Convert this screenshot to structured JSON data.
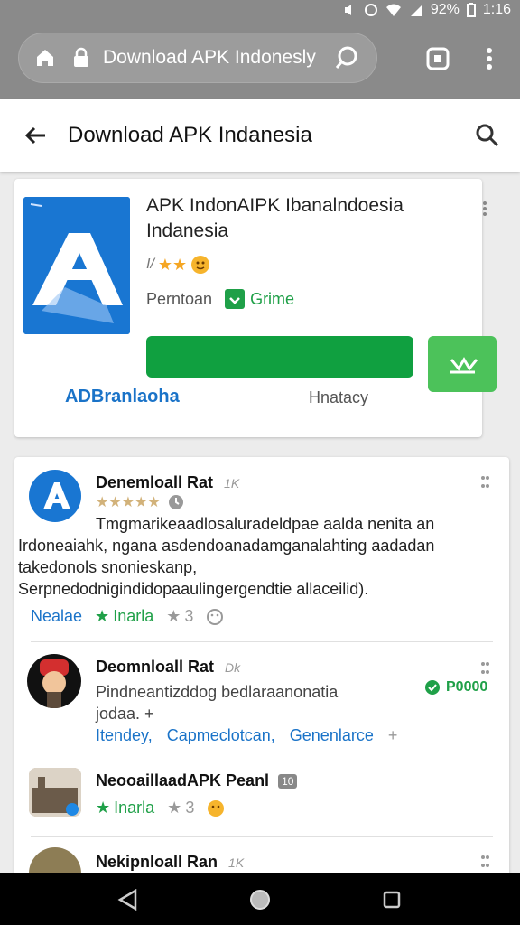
{
  "status": {
    "battery": "92%",
    "time": "1:16"
  },
  "browser": {
    "url": "Download APK Indonesly"
  },
  "appbar": {
    "title": "Download APK Indanesia"
  },
  "app": {
    "title": "APK IndonAIPK IbanalndoesiaIndanesia",
    "title_line1": "APK IndonAIPK Ibanalndoesia",
    "title_line2": "Indanesia",
    "rating_prefix": "I/",
    "meta_left": "Perntoan",
    "meta_right": "Grime",
    "developer": "ADBranlaoha",
    "secondary": "Hnatacy"
  },
  "reviews": [
    {
      "name": "Denemloall Rat",
      "count": "1K",
      "body_lines": [
        "Tmgmarikeaadlosaluradeldpae aalda nenita an",
        "Irdoneaiahk, ngana asdendoanadamganalahting aadadan",
        "takedonols snonieskanp,",
        "Serpnedodnigindidopaaulingergendtie allaceilid)."
      ],
      "footer_left": "Nealae",
      "footer_mid": "Inarla",
      "footer_right": "3"
    },
    {
      "name": "Deomnloall Rat",
      "count": "Dk",
      "body_lines": [
        "Pindneantizddog bedlaraanonatia",
        "jodaa.  +"
      ],
      "badge": "P0000",
      "links": [
        "Itendey,",
        "Capmeclotcan,",
        "Genenlarce"
      ],
      "plus": "+"
    },
    {
      "name": "NeooaillaadAPK Peanl",
      "count": "10",
      "footer_mid": "Inarla",
      "footer_right": "3"
    },
    {
      "name": "Nekipnloall Ran",
      "count": "1K"
    }
  ],
  "colors": {
    "brand_blue": "#1976d2",
    "install_green": "#10a040",
    "side_green": "#4cc25a",
    "star": "#f5a623"
  }
}
